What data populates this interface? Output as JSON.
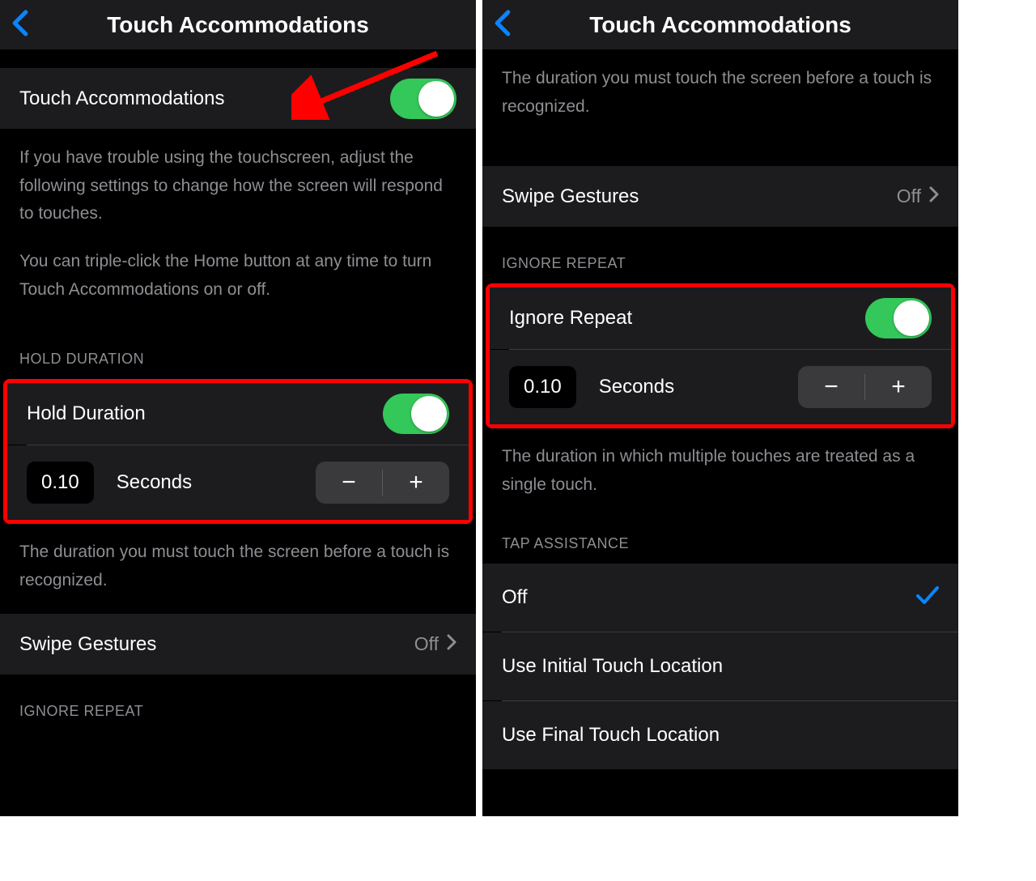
{
  "left": {
    "header": {
      "title": "Touch Accommodations"
    },
    "main_toggle": {
      "label": "Touch Accommodations",
      "on": true
    },
    "footer1": "If you have trouble using the touchscreen, adjust the following settings to change how the screen will respond to touches.",
    "footer2": "You can triple-click the Home button at any time to turn Touch Accommodations on or off.",
    "hold_duration": {
      "section_header": "HOLD DURATION",
      "row_label": "Hold Duration",
      "on": true,
      "value": "0.10",
      "unit": "Seconds",
      "footer": "The duration you must touch the screen before a touch is recognized."
    },
    "swipe": {
      "label": "Swipe Gestures",
      "value": "Off"
    },
    "ignore_repeat_header": "IGNORE REPEAT"
  },
  "right": {
    "header": {
      "title": "Touch Accommodations"
    },
    "hold_footer": "The duration you must touch the screen before a touch is recognized.",
    "swipe": {
      "label": "Swipe Gestures",
      "value": "Off"
    },
    "ignore_repeat": {
      "section_header": "IGNORE REPEAT",
      "row_label": "Ignore Repeat",
      "on": true,
      "value": "0.10",
      "unit": "Seconds",
      "footer": "The duration in which multiple touches are treated as a single touch."
    },
    "tap_assistance": {
      "section_header": "TAP ASSISTANCE",
      "options": [
        {
          "label": "Off",
          "selected": true
        },
        {
          "label": "Use Initial Touch Location",
          "selected": false
        },
        {
          "label": "Use Final Touch Location",
          "selected": false
        }
      ]
    }
  },
  "colors": {
    "accent_blue": "#0a84ff",
    "toggle_green": "#34c759",
    "annotation_red": "#ff0000"
  }
}
